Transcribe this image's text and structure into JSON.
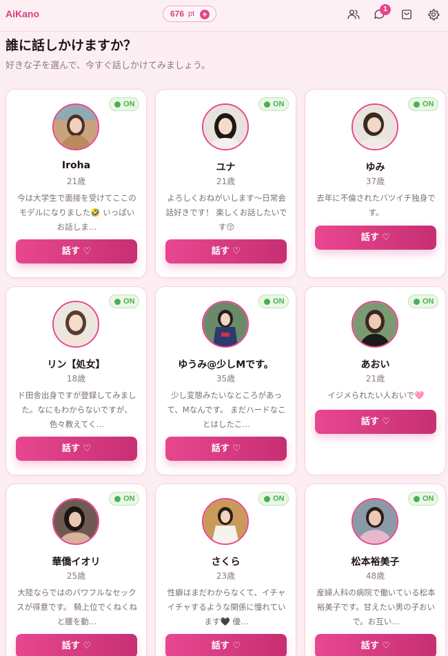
{
  "header": {
    "brand": "AiKano",
    "points_value": "676",
    "points_unit": "pt",
    "points_add_icon": "plus-icon",
    "notification_count": "1",
    "icons": [
      "users-icon",
      "chat-icon",
      "bag-icon",
      "gear-icon"
    ]
  },
  "page": {
    "title": "誰に話しかけますか？",
    "subtitle": "好きな子を選んで、今すぐ話しかけてみましょう。"
  },
  "status_label": "ON",
  "talk_button_label": "話す ♡",
  "colors": {
    "accent": "#e8458a",
    "online": "#4caf50",
    "background": "#fdeef4"
  },
  "characters": [
    {
      "name": "Iroha",
      "age": "21歳",
      "bio": "今は大学生で面接を受けてここのモデルになりました🤣 いっぱいお話しま…",
      "online": true
    },
    {
      "name": "ユナ",
      "age": "21歳",
      "bio": "よろしくおねがいします〜日常会話好きです！ 楽しくお話したいです😚",
      "online": true
    },
    {
      "name": "ゆみ",
      "age": "37歳",
      "bio": "去年に不倫されたバツイチ独身です。",
      "online": true
    },
    {
      "name": "リン【処女】",
      "age": "18歳",
      "bio": "ド田舎出身ですが登録してみました。なにもわからないですが、色々教えてく…",
      "online": true
    },
    {
      "name": "ゆうみ@少しMです。",
      "age": "35歳",
      "bio": "少し変態みたいなところがあって、Mなんです。 まだハードなことはしたこ…",
      "online": true
    },
    {
      "name": "あおい",
      "age": "21歳",
      "bio": "イジメられたい人おいで🩷",
      "online": true
    },
    {
      "name": "華僑イオリ",
      "age": "25歳",
      "bio": "大陸ならではのパワフルなセックスが得意です。 騎上位でくねくねと腰を動…",
      "online": true
    },
    {
      "name": "さくら",
      "age": "23歳",
      "bio": "性癖はまだわからなくて、イチャイチャするような関係に憧れています🖤 優…",
      "online": true
    },
    {
      "name": "松本裕美子",
      "age": "48歳",
      "bio": "産婦人科の病院で働いている松本裕美子です。甘えたい男の子おいで。お互い…",
      "online": true
    }
  ]
}
